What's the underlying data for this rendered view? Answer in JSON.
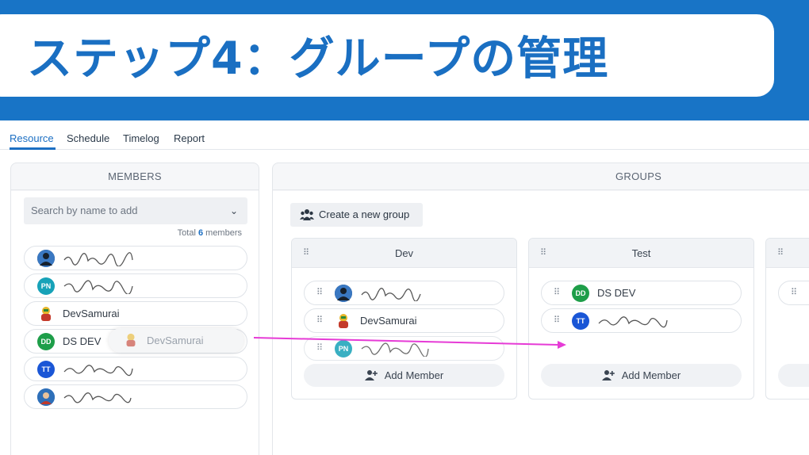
{
  "banner": {
    "title": "ステップ4：グループの管理"
  },
  "tabs": [
    {
      "label": "Resource",
      "active": true
    },
    {
      "label": "Schedule",
      "active": false
    },
    {
      "label": "Timelog",
      "active": false
    },
    {
      "label": "Report",
      "active": false
    }
  ],
  "members_panel": {
    "title": "MEMBERS",
    "search_placeholder": "Search by name to add",
    "total_prefix": "Total",
    "total_count": "6",
    "total_suffix": "members",
    "members": [
      {
        "name": "",
        "avatar": "photo"
      },
      {
        "name": "",
        "initials": "PN",
        "color": "#17a2b8"
      },
      {
        "name": "DevSamurai",
        "avatar": "samurai"
      },
      {
        "name": "DS DEV",
        "initials": "DD",
        "color": "#1e9e49"
      },
      {
        "name": "",
        "initials": "TT",
        "color": "#1a56d6"
      },
      {
        "name": "",
        "avatar": "photo"
      }
    ],
    "drag_ghost_name": "DevSamurai"
  },
  "groups_panel": {
    "title": "GROUPS",
    "create_label": "Create a new group",
    "add_member_label": "Add Member",
    "groups": [
      {
        "name": "Dev",
        "members": [
          {
            "name": "",
            "avatar": "photo"
          },
          {
            "name": "DevSamurai",
            "avatar": "samurai"
          },
          {
            "name": "",
            "initials": "PN",
            "color": "#17a2b8"
          }
        ]
      },
      {
        "name": "Test",
        "members": [
          {
            "name": "DS DEV",
            "initials": "DD",
            "color": "#1e9e49"
          },
          {
            "name": "",
            "initials": "TT",
            "color": "#1a56d6"
          }
        ]
      }
    ]
  },
  "colors": {
    "brand": "#1874c6",
    "accent": "#1c6fc3",
    "arrow": "#e63bd6"
  }
}
